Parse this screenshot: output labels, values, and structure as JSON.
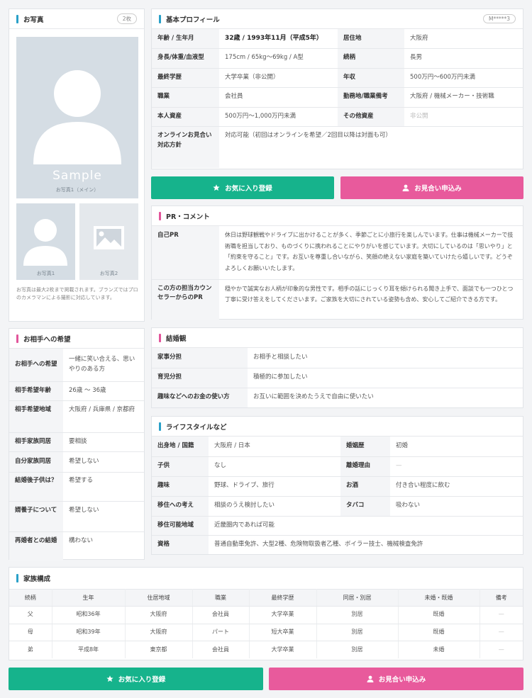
{
  "photos": {
    "title": "お写真",
    "count": "2枚",
    "sample": "Sample",
    "main_caption": "お写真1（メイン）",
    "thumb1_caption": "お写真1",
    "thumb2_caption": "お写真2",
    "note": "お写真は最大2枚まで掲載されます。ブランズではプロのカメラマンによる撮影に対応しています。"
  },
  "profile": {
    "title": "基本プロフィール",
    "id": "M*****3",
    "rows": [
      {
        "k1": "年齢 / 生年月",
        "v1": "32歳 / 1993年11月（平成5年）",
        "k2": "居住地",
        "v2": "大阪府"
      },
      {
        "k1": "身長/体重/血液型",
        "v1": "175cm / 65kg〜69kg / A型",
        "k2": "続柄",
        "v2": "長男"
      },
      {
        "k1": "最終学歴",
        "v1": "大学卒業（非公開）",
        "k2": "年収",
        "v2": "500万円〜600万円未満"
      },
      {
        "k1": "職業",
        "v1": "会社員",
        "k2": "勤務地/職業備考",
        "v2": "大阪府 / 機械メーカー・技術職"
      },
      {
        "k1": "本人資産",
        "v1": "500万円〜1,000万円未満",
        "k2": "その他資産",
        "v2": "非公開"
      }
    ],
    "online_key": "オンラインお見合い対応方針",
    "online_value": "対応可能（初回はオンラインを希望／2回目以降は対面も可）"
  },
  "buttons": {
    "favorite": "お気に入り登録",
    "apply": "お見合い申込み"
  },
  "pr": {
    "title": "PR・コメント",
    "self_key": "自己PR",
    "self_text": "休日は野球観戦やドライブに出かけることが多く、季節ごとに小旅行を楽しんでいます。仕事は機械メーカーで技術職を担当しており、ものづくりに携われることにやりがいを感じています。大切にしているのは「思いやり」と「約束を守ること」です。お互いを尊重し合いながら、笑顔の絶えない家庭を築いていけたら嬉しいです。どうぞよろしくお願いいたします。",
    "counselor_key": "この方の担当カウンセラーからのPR",
    "counselor_text": "穏やかで誠実なお人柄が印象的な男性です。相手の話にじっくり耳を傾けられる聞き上手で、面談でも一つひとつ丁寧に受け答えをしてくださいます。ご家族を大切にされている姿勢も含め、安心してご紹介できる方です。"
  },
  "hope": {
    "title": "お相手への希望",
    "rows": [
      {
        "k": "お相手への希望",
        "v": "一緒に笑い合える、思いやりのある方"
      },
      {
        "k": "相手希望年齢",
        "v": "26歳 〜 36歳"
      },
      {
        "k": "相手希望地域",
        "v": "大阪府 / 兵庫県 / 京都府"
      },
      {
        "k": "相手家族同居",
        "v": "要相談"
      },
      {
        "k": "自分家族同居",
        "v": "希望しない"
      },
      {
        "k": "結婚後子供は？",
        "v": "希望する"
      },
      {
        "k": "婿養子について",
        "v": "希望しない"
      },
      {
        "k": "再婚者との結婚",
        "v": "構わない"
      }
    ]
  },
  "marriage": {
    "title": "結婚観",
    "rows": [
      {
        "k": "家事分担",
        "v": "お相手と相談したい"
      },
      {
        "k": "育児分担",
        "v": "積極的に参加したい"
      },
      {
        "k": "趣味などへのお金の使い方",
        "v": "お互いに範囲を決めたうえで自由に使いたい"
      }
    ]
  },
  "lifestyle": {
    "title": "ライフスタイルなど",
    "rows": [
      {
        "k1": "出身地 / 国籍",
        "v1": "大阪府 / 日本",
        "k2": "婚姻歴",
        "v2": "初婚"
      },
      {
        "k1": "子供",
        "v1": "なし",
        "k2": "離婚理由",
        "v2": "—"
      },
      {
        "k1": "趣味",
        "v1": "野球、ドライブ、旅行",
        "k2": "お酒",
        "v2": "付き合い程度に飲む"
      },
      {
        "k1": "移住への考え",
        "v1": "相談のうえ検討したい",
        "k2": "タバコ",
        "v2": "吸わない"
      }
    ],
    "move_key": "移住可能地域",
    "move_value": "近畿圏内であれば可能",
    "qual_key": "資格",
    "qual_value": "普通自動車免許、大型2種、危険物取扱者乙種、ボイラー技士、機械検査免許"
  },
  "family": {
    "title": "家族構成",
    "headers": [
      "続柄",
      "生年",
      "住居地域",
      "職業",
      "最終学歴",
      "同居・別居",
      "未婚・既婚",
      "備考"
    ],
    "rows": [
      [
        "父",
        "昭和36年",
        "大阪府",
        "会社員",
        "大学卒業",
        "別居",
        "既婚",
        "—"
      ],
      [
        "母",
        "昭和39年",
        "大阪府",
        "パート",
        "短大卒業",
        "別居",
        "既婚",
        "—"
      ],
      [
        "弟",
        "平成8年",
        "東京都",
        "会社員",
        "大学卒業",
        "別居",
        "未婚",
        "—"
      ]
    ]
  },
  "icons": {
    "favorite": "star-icon",
    "apply": "person-icon",
    "avatar": "person-silhouette-icon",
    "image": "image-placeholder-icon"
  },
  "colors": {
    "accent_blue": "#2aa0c8",
    "accent_pink": "#e2559b",
    "green_button": "#16b38c",
    "pink_button": "#e85a9c"
  }
}
